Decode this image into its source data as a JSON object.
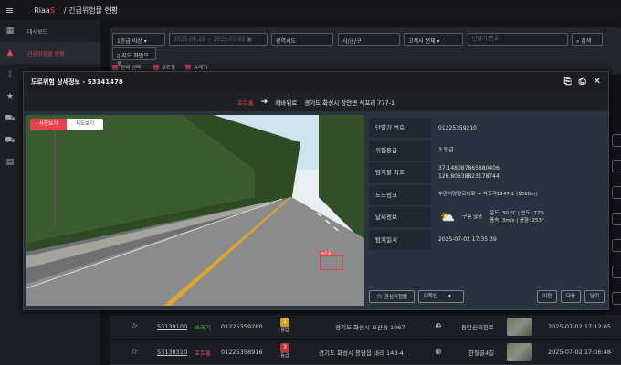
{
  "topbar": {
    "brand_pre": "Riaa",
    "brand_accent": "S",
    "breadcrumb": "/   긴급위험물 현황"
  },
  "sidebar": {
    "items": [
      {
        "label": "대시보드",
        "icon": "dashboard-icon"
      },
      {
        "label": "긴급위험물 현황",
        "icon": "warning-icon",
        "active": true
      },
      {
        "label": "",
        "icon": "sliders-icon"
      },
      {
        "label": "",
        "icon": "star-icon"
      },
      {
        "label": "",
        "icon": "car-icon"
      },
      {
        "label": "",
        "icon": "car-front-icon"
      },
      {
        "label": "",
        "icon": "chart-icon"
      }
    ]
  },
  "filter": {
    "grade": "1등급 이상",
    "date_range": "2025-06-25 ~ 2025-07-02",
    "province": "광역시도",
    "city": "시/군/구",
    "client": "고객사 전체",
    "terminal_placeholder": "단말기 번호",
    "search": "검색",
    "map_view": "지도 화면으로",
    "checks": [
      "전체 선택",
      "포트홀",
      "쓰레기"
    ]
  },
  "modal": {
    "title": "도로위험 상세정보 - 53141478",
    "category": "포트홀",
    "direction": "매바위로",
    "address": "경기도 화성시 장안면 석포리 777-1",
    "tabs": [
      "사진보기",
      "지도보기"
    ],
    "detection_label": "포트홀",
    "info": [
      {
        "key": "단말기 번호",
        "value": "01225359210"
      },
      {
        "key": "위험등급",
        "value": "3 등급"
      },
      {
        "key": "탐지물 좌표",
        "value": "37.148087865880406",
        "value2": "126.80638823178744"
      },
      {
        "key": "노드링크",
        "value": "부강석당말교차로 → 석포리1247-1 (1598m)"
      },
      {
        "key": "날씨정보",
        "weather": "구름 많음",
        "temp": "온도: 30 °C | 습도: 77%",
        "wind": "풍속: 3m/s | 풍향: 253°"
      },
      {
        "key": "탐지일시",
        "value": "2025-07-02 17:35:39"
      }
    ],
    "buttons": {
      "favorite": "관심위험물",
      "status": "미확인",
      "prev": "이전",
      "next": "다음",
      "close": "닫기"
    }
  },
  "rows": [
    {
      "id": "53139100",
      "type": "쓰레기",
      "type_color": "#4caf50",
      "terminal": "01225359280",
      "grade": "2",
      "grade_label": "등급",
      "grade_color": "#d4a017",
      "address": "경기도 화성시 오산동 1067",
      "road": "동탄신리천로",
      "time": "2025-07-02 17:12:05"
    },
    {
      "id": "53138310",
      "type": "포트홀",
      "type_color": "#e8414f",
      "terminal": "01225358916",
      "grade": "3",
      "grade_label": "등급",
      "grade_color": "#c0343f",
      "address": "경기도 화성시 봉담읍 내리 143-4",
      "road": "한절골4길",
      "time": "2025-07-02 17:06:48"
    }
  ]
}
